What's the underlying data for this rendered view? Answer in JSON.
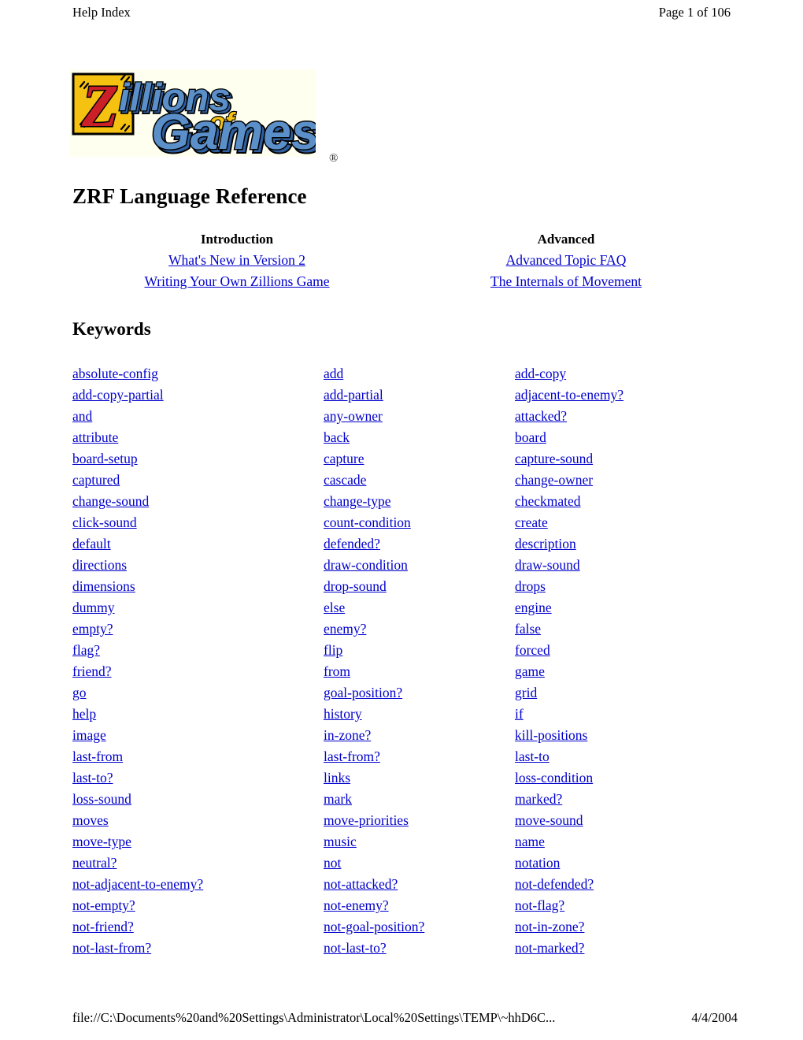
{
  "header": {
    "left": "Help Index",
    "right": "Page 1 of 106"
  },
  "logo": {
    "alt": "Zillions of Games",
    "word_z": "Z",
    "word_illions": "illions",
    "word_of": "of",
    "word_games": "Games",
    "registered_mark": "®",
    "colors": {
      "tile_yellow": "#F5C211",
      "z_red": "#CC2029",
      "blue": "#5B8FC9",
      "blue_dark": "#2F5F9E",
      "background": "#FFFFF0",
      "outline": "#000000"
    }
  },
  "document": {
    "title": "ZRF Language Reference",
    "keywords_heading": "Keywords"
  },
  "nav": {
    "columns": [
      {
        "heading": "Introduction",
        "links": [
          "What's New in Version 2",
          "Writing Your Own Zillions Game"
        ]
      },
      {
        "heading": "Advanced",
        "links": [
          "Advanced Topic FAQ",
          "The Internals of Movement"
        ]
      }
    ]
  },
  "keywords": {
    "link_color": "#0000CC",
    "rows": [
      [
        "absolute-config",
        "add",
        "add-copy"
      ],
      [
        "add-copy-partial",
        "add-partial",
        "adjacent-to-enemy?"
      ],
      [
        "and",
        "any-owner",
        "attacked?"
      ],
      [
        "attribute",
        "back",
        "board"
      ],
      [
        "board-setup",
        "capture",
        "capture-sound"
      ],
      [
        "captured",
        "cascade",
        "change-owner"
      ],
      [
        "change-sound",
        "change-type",
        "checkmated"
      ],
      [
        "click-sound",
        "count-condition",
        "create"
      ],
      [
        "default",
        "defended?",
        "description"
      ],
      [
        "directions",
        "draw-condition",
        "draw-sound"
      ],
      [
        "dimensions",
        "drop-sound",
        "drops"
      ],
      [
        "dummy",
        "else",
        "engine"
      ],
      [
        "empty?",
        "enemy?",
        "false"
      ],
      [
        "flag?",
        "flip",
        "forced"
      ],
      [
        "friend?",
        "from",
        "game"
      ],
      [
        "go",
        "goal-position?",
        "grid"
      ],
      [
        "help",
        "history",
        "if"
      ],
      [
        "image",
        "in-zone?",
        "kill-positions"
      ],
      [
        "last-from",
        "last-from?",
        "last-to"
      ],
      [
        "last-to?",
        "links",
        "loss-condition"
      ],
      [
        "loss-sound",
        "mark",
        "marked?"
      ],
      [
        "moves",
        "move-priorities",
        "move-sound"
      ],
      [
        "move-type",
        "music",
        "name"
      ],
      [
        "neutral?",
        "not",
        "notation"
      ],
      [
        "not-adjacent-to-enemy?",
        "not-attacked?",
        "not-defended?"
      ],
      [
        "not-empty?",
        "not-enemy?",
        "not-flag?"
      ],
      [
        "not-friend?",
        "not-goal-position?",
        "not-in-zone?"
      ],
      [
        "not-last-from?",
        "not-last-to?",
        "not-marked?"
      ]
    ]
  },
  "footer": {
    "path": "file://C:\\Documents%20and%20Settings\\Administrator\\Local%20Settings\\TEMP\\~hhD6C...",
    "date": "4/4/2004"
  }
}
